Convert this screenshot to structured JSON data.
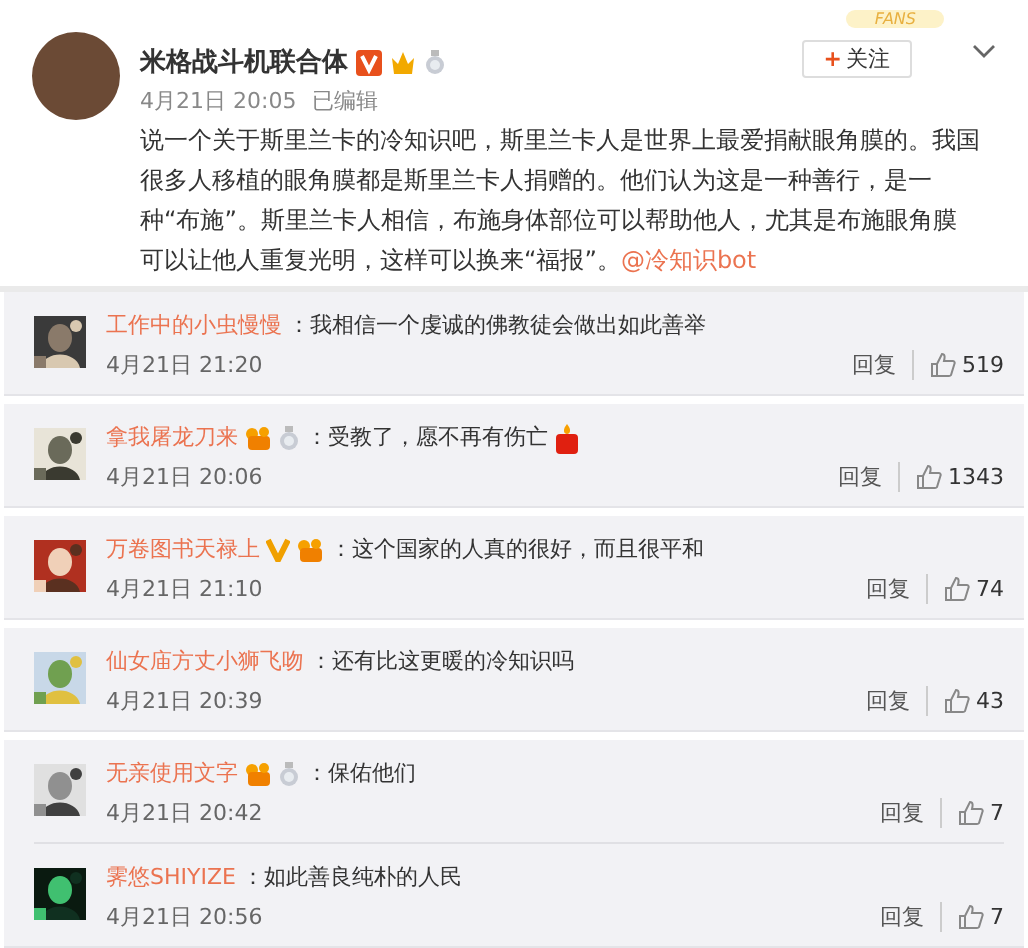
{
  "post": {
    "author": "米格战斗机联合体",
    "badges": [
      {
        "kind": "verified"
      },
      {
        "kind": "crown"
      },
      {
        "kind": "medal"
      }
    ],
    "time": "4月21日 20:05",
    "edited": "已编辑",
    "text": "说一个关于斯里兰卡的冷知识吧，斯里兰卡人是世界上最爱捐献眼角膜的。我国很多人移植的眼角膜都是斯里兰卡人捐赠的。他们认为这是一种善行，是一种“布施”。斯里兰卡人相信，布施身体部位可以帮助他人，尤其是布施眼角膜可以让他人重复光明，这样可以换来“福报”。",
    "mention": "@冷知识bot",
    "follow": {
      "icon": "+",
      "label": "关注"
    },
    "fans_tag": "FANS"
  },
  "comment_cards": [
    {
      "comments": [
        {
          "author": "工作中的小虫慢慢",
          "text": "：我相信一个虔诚的佛教徒会做出如此善举",
          "time": "4月21日 21:20",
          "reply": "回复",
          "likes": "519"
        }
      ]
    },
    {
      "comments": [
        {
          "author": "拿我屠龙刀来",
          "badges": [
            {
              "kind": "vip"
            },
            {
              "kind": "medal"
            }
          ],
          "text": "：受教了，愿不再有伤亡",
          "end_emoji": {
            "kind": "candle"
          },
          "time": "4月21日 20:06",
          "reply": "回复",
          "likes": "1343"
        }
      ]
    },
    {
      "comments": [
        {
          "author": "万卷图书天禄上",
          "badges": [
            {
              "kind": "verified_plain"
            },
            {
              "kind": "vip"
            }
          ],
          "text": "：这个国家的人真的很好，而且很平和",
          "time": "4月21日 21:10",
          "reply": "回复",
          "likes": "74"
        }
      ]
    },
    {
      "comments": [
        {
          "author": "仙女庙方丈小狮飞吻",
          "text": "：还有比这更暖的冷知识吗",
          "time": "4月21日 20:39",
          "reply": "回复",
          "likes": "43"
        }
      ]
    },
    {
      "comments": [
        {
          "author": "无亲使用文字",
          "badges": [
            {
              "kind": "vip"
            },
            {
              "kind": "medal"
            }
          ],
          "text": "：保佑他们",
          "time": "4月21日 20:42",
          "reply": "回复",
          "likes": "7"
        },
        {
          "author": "霁悠SHIYIZE",
          "text": "：如此善良纯朴的人民",
          "time": "4月21日 20:56",
          "reply": "回复",
          "likes": "7"
        }
      ]
    }
  ]
}
